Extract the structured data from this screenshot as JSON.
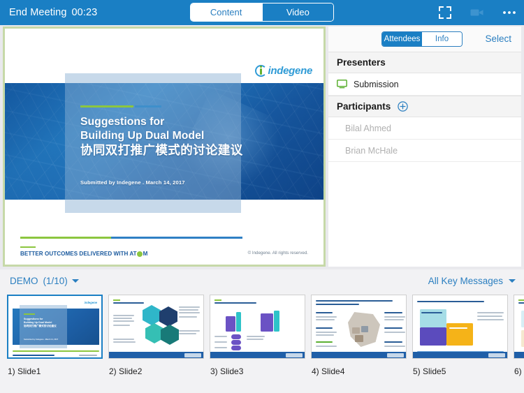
{
  "topbar": {
    "end_meeting_label": "End Meeting",
    "timer": "00:23",
    "segments": [
      {
        "label": "Content",
        "selected": true
      },
      {
        "label": "Video",
        "selected": false
      }
    ],
    "icons": [
      {
        "name": "fullscreen-icon",
        "label": "Fullscreen"
      },
      {
        "name": "video-camera-icon",
        "label": "Video Camera"
      },
      {
        "name": "more-options-icon",
        "label": "More"
      }
    ],
    "accent_color": "#1a7fc4",
    "text_color": "#ffffff"
  },
  "slide": {
    "brand": "indegene",
    "title_line1": "Suggestions for",
    "title_line2": "Building Up Dual Model",
    "title_line3": "协同双打推广模式的讨论建议",
    "submitted": "Submitted by Indegene . March 14, 2017",
    "tagline_before": "BETTER OUTCOMES DELIVERED WITH AT",
    "tagline_after": "M",
    "copyright": "© Indegene. All rights reserved.",
    "border_color": "#c6d9a8",
    "accent_green": "#8cc63f",
    "accent_blue": "#2f80c4"
  },
  "panel": {
    "tabs": [
      {
        "label": "Attendees",
        "selected": true
      },
      {
        "label": "Info",
        "selected": false
      }
    ],
    "select_label": "Select",
    "sections": [
      {
        "title": "Presenters",
        "has_add": false,
        "rows": [
          {
            "name": "Submission",
            "icon": "monitor-icon",
            "dim": false
          }
        ]
      },
      {
        "title": "Participants",
        "has_add": true,
        "rows": [
          {
            "name": "Bilal Ahmed",
            "icon": "",
            "dim": true
          },
          {
            "name": "Brian McHale",
            "icon": "",
            "dim": true
          }
        ]
      }
    ]
  },
  "bottom": {
    "deck_name": "DEMO",
    "deck_count": "(1/10)",
    "key_messages_label": "All Key Messages",
    "thumbnails": [
      {
        "label": "1) Slide1",
        "selected": true
      },
      {
        "label": "2) Slide2",
        "selected": false
      },
      {
        "label": "3) Slide3",
        "selected": false
      },
      {
        "label": "4) Slide4",
        "selected": false
      },
      {
        "label": "5) Slide5",
        "selected": false
      },
      {
        "label": "6)",
        "selected": false
      }
    ]
  }
}
